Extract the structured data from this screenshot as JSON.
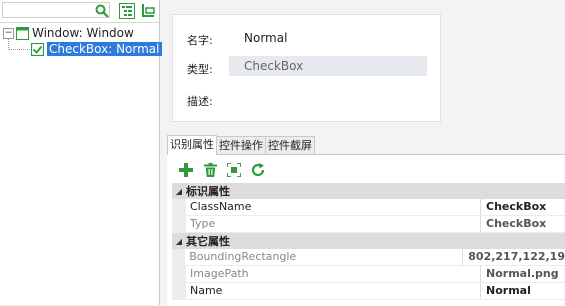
{
  "search": {
    "placeholder": ""
  },
  "tree": {
    "root_label": "Window: Window",
    "child_label": "CheckBox: Normal"
  },
  "info": {
    "name_label": "名字:",
    "name_value": "Normal",
    "type_label": "类型:",
    "type_value": "CheckBox",
    "desc_label": "描述:"
  },
  "tabs": [
    {
      "label": "识别属性"
    },
    {
      "label": "控件操作"
    },
    {
      "label": "控件截屏"
    }
  ],
  "grid": {
    "group1": "标识属性",
    "group2": "其它属性",
    "rows": [
      {
        "name": "ClassName",
        "value": "CheckBox"
      },
      {
        "name": "Type",
        "value": "CheckBox"
      },
      {
        "name": "BoundingRectangle",
        "value": "802,217,122,19"
      },
      {
        "name": "ImagePath",
        "value": "Normal.png"
      },
      {
        "name": "Name",
        "value": "Normal"
      }
    ]
  },
  "colors": {
    "accent": "#2f7bd9",
    "add_green": "#2e9b3a"
  }
}
